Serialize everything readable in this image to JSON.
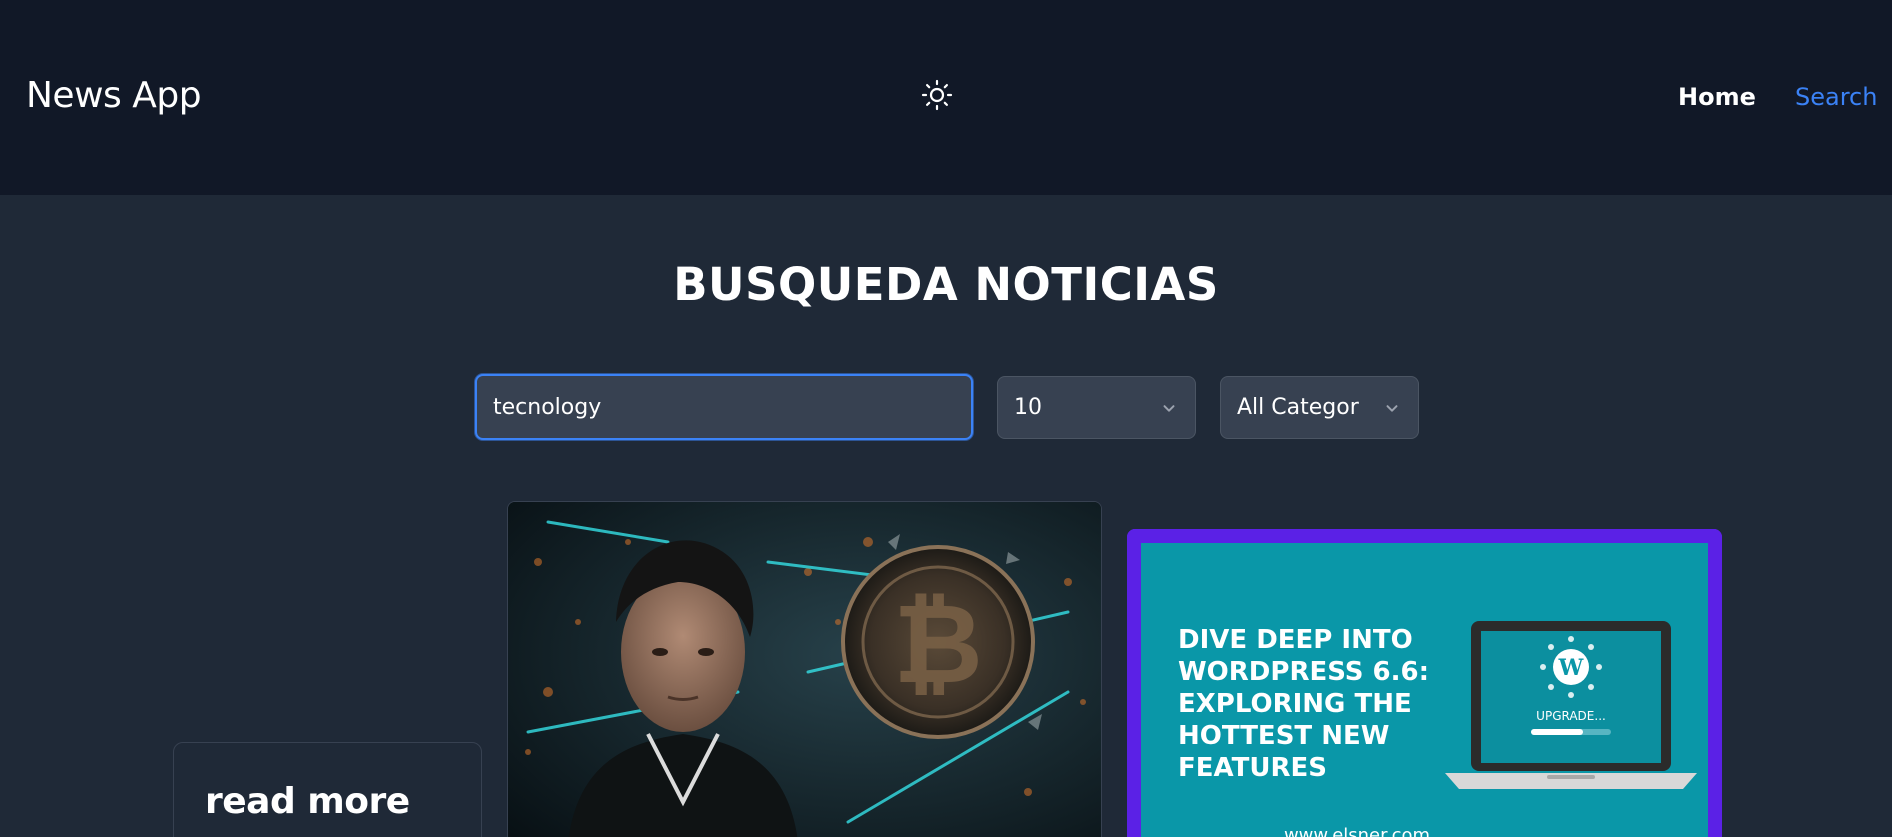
{
  "navbar": {
    "brand": "News App",
    "theme_icon": "sun-icon",
    "links": [
      {
        "label": "Home",
        "active": false
      },
      {
        "label": "Search",
        "active": true
      }
    ]
  },
  "page": {
    "title": "BUSQUEDA NOTICIAS"
  },
  "filters": {
    "search_value": "tecnology",
    "page_size": "10",
    "category": "All Categories"
  },
  "cards": [
    {
      "title": "read more"
    },
    {
      "image": "news-image-bitcoin"
    },
    {
      "image": "news-image-wordpress",
      "image_text_lines": [
        "DIVE DEEP INTO",
        "WORDPRESS 6.6:",
        "EXPLORING THE",
        "HOTTEST NEW",
        "FEATURES"
      ],
      "image_badge": "UPGRADE...",
      "image_footer": "www.elsner.com"
    }
  ],
  "colors": {
    "nav_bg": "#111827",
    "page_bg": "#1f2937",
    "accent": "#3b82f6",
    "input_bg": "#374151",
    "card_accent": "#5b21e6",
    "image_teal": "#0a97a8"
  }
}
